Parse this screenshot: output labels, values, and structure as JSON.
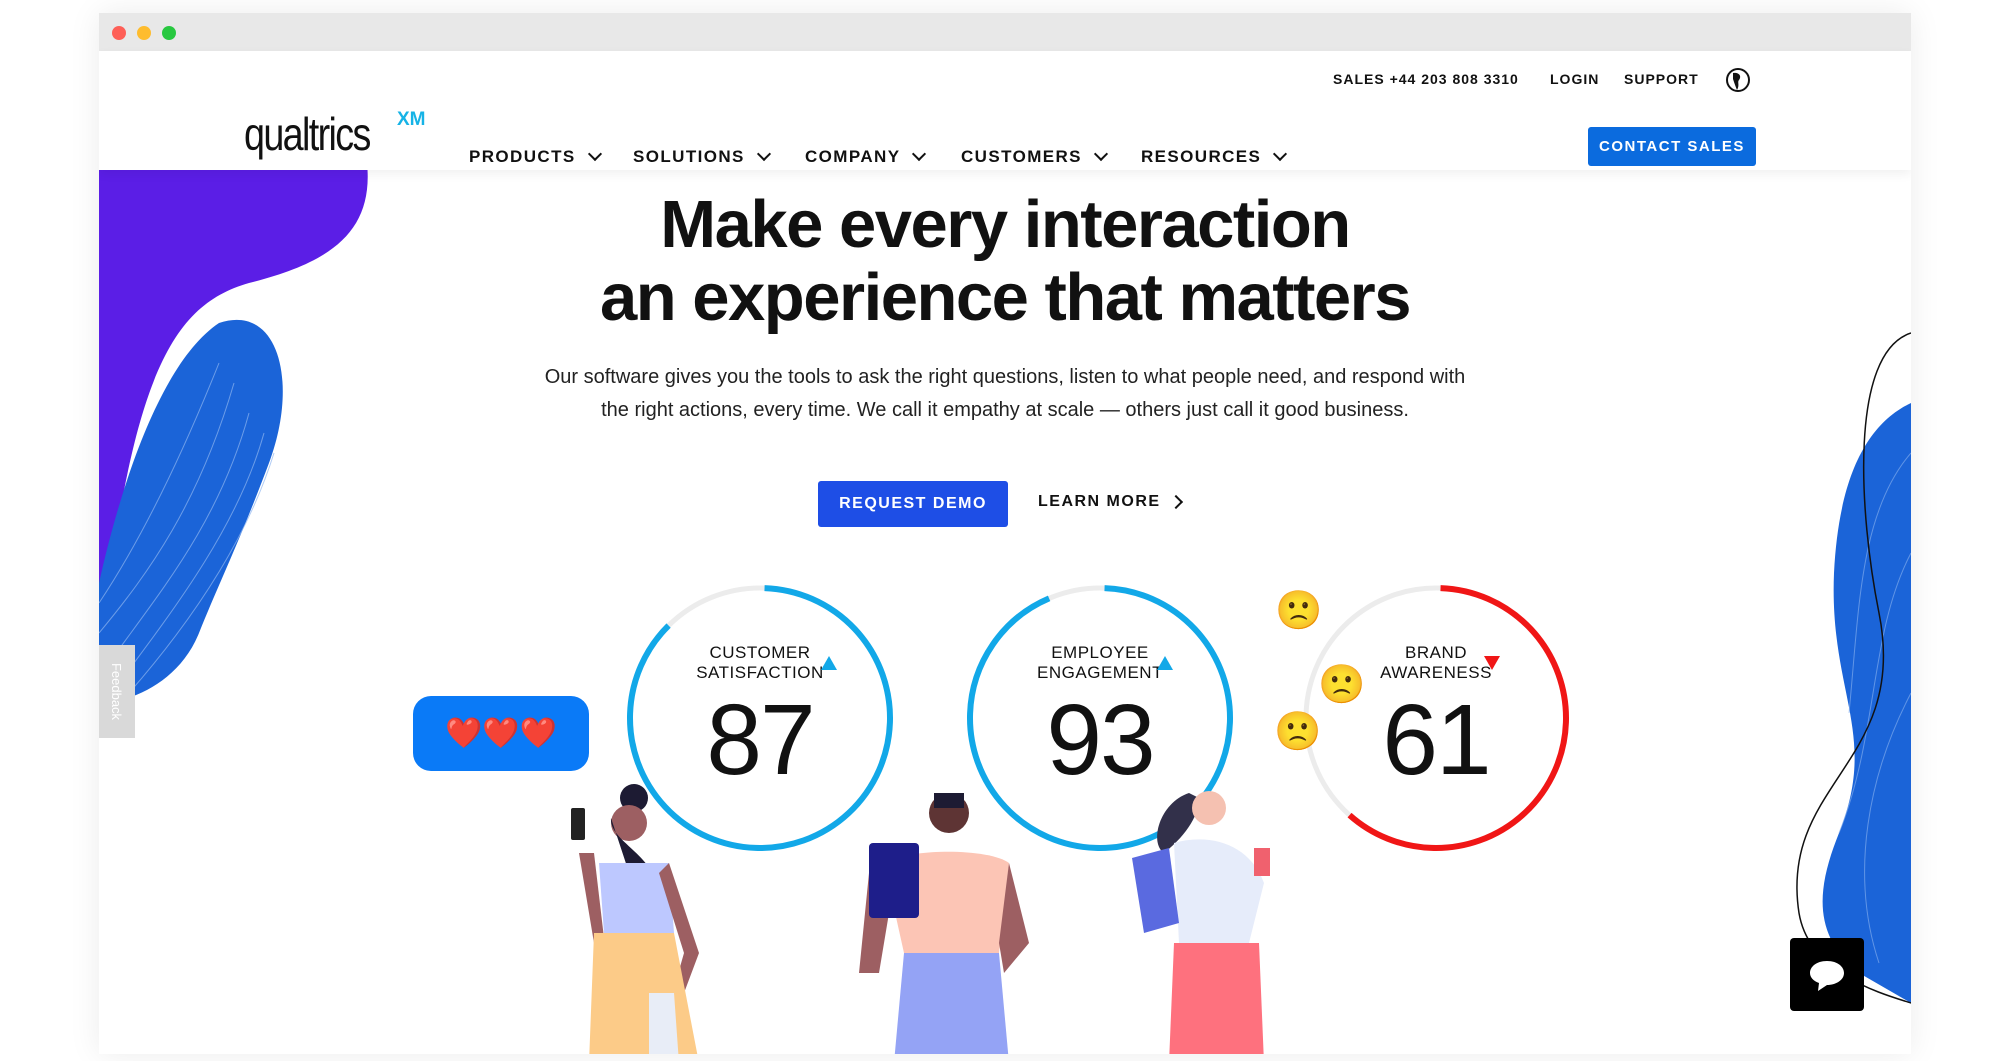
{
  "browser": {
    "controls": [
      "close",
      "minimize",
      "maximize"
    ],
    "colors": [
      "#fe5f57",
      "#febc2e",
      "#28c840"
    ]
  },
  "utility": {
    "sales": "SALES +44 203 808 3310",
    "login": "LOGIN",
    "support": "SUPPORT",
    "globe_icon": "globe-icon"
  },
  "logo": {
    "text": "qualtrics",
    "suffix": "XM"
  },
  "nav": [
    {
      "label": "PRODUCTS"
    },
    {
      "label": "SOLUTIONS"
    },
    {
      "label": "COMPANY"
    },
    {
      "label": "CUSTOMERS"
    },
    {
      "label": "RESOURCES"
    }
  ],
  "contact_sales": "CONTACT SALES",
  "hero": {
    "line1": "Make every interaction",
    "line2": "an experience that matters",
    "para1": "Our software gives you the tools to ask the right questions, listen to what people need, and respond with",
    "para2": "the right actions, every time. We call it empathy at scale — others just call it good business.",
    "request_demo": "REQUEST DEMO",
    "learn_more": "LEARN MORE"
  },
  "gauges": [
    {
      "l1": "CUSTOMER",
      "l2": "SATISFACTION",
      "value": "87",
      "trend": "up",
      "color": "#12a8e8"
    },
    {
      "l1": "EMPLOYEE",
      "l2": "ENGAGEMENT",
      "value": "93",
      "trend": "up",
      "color": "#12a8e8"
    },
    {
      "l1": "BRAND",
      "l2": "AWARENESS",
      "value": "61",
      "trend": "down",
      "color": "#f01616"
    }
  ],
  "bubble": "❤️❤️❤️",
  "feedback": "Feedback",
  "colors": {
    "brand_blue": "#0b6bde",
    "purple": "#5b1ee6"
  }
}
